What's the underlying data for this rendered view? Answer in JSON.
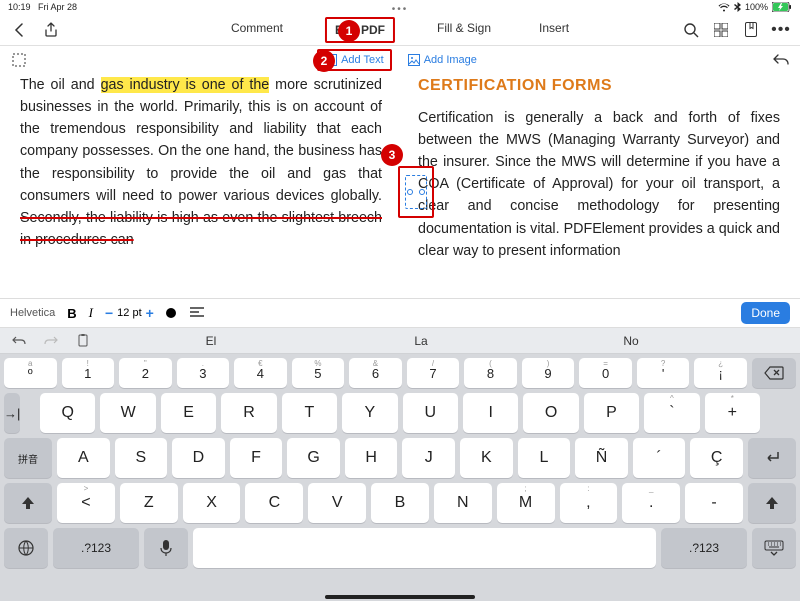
{
  "status": {
    "time": "10:19",
    "date": "Fri Apr 28",
    "battery": "100%"
  },
  "tabs": {
    "comment": "Comment",
    "edit": "Edit PDF",
    "fillsign": "Fill & Sign",
    "insert": "Insert"
  },
  "secbar": {
    "add_text": "Add Text",
    "add_image": "Add Image"
  },
  "callouts": {
    "c1": "1",
    "c2": "2",
    "c3": "3"
  },
  "doc": {
    "left_pre": "The oil and ",
    "left_hl": "gas industry is one of the",
    "left_post": " more scrutinized businesses in the world. Primarily, this is on account of the tremendous responsibility and liability that each company possesses. On the one hand, the business has the responsibility to provide the oil and gas that consumers will need to power various devices globally. ",
    "left_strike": "Secondly, the liability is high as even the slightest breech in procedures can",
    "right_heading": "Certification Forms",
    "right_body": "Certification is generally a back and forth of fixes between the MWS (Managing Warranty Surveyor) and the insurer. Since the MWS will determine if you have a COA (Certificate of Approval) for your oil transport, a clear and concise methodology for presenting documentation is vital. PDFElement provides a quick and clear way to present information"
  },
  "fmt": {
    "font": "Helvetica",
    "bold": "B",
    "italic": "I",
    "size": "12 pt",
    "done": "Done"
  },
  "sug": {
    "s1": "El",
    "s2": "La",
    "s3": "No"
  },
  "kbd": {
    "numhints": [
      "a",
      "!",
      "\"",
      ".",
      "€",
      "%",
      "&",
      "/",
      "(",
      ")",
      "=",
      "?",
      "¿"
    ],
    "nums": [
      "º",
      "1",
      "2",
      "3",
      "4",
      "5",
      "6",
      "7",
      "8",
      "9",
      "0",
      "'",
      "¡"
    ],
    "row1hints": [
      "",
      "",
      "",
      "",
      "",
      "",
      "",
      "",
      "",
      "",
      "^",
      "*"
    ],
    "row1": [
      "Q",
      "W",
      "E",
      "R",
      "T",
      "Y",
      "U",
      "I",
      "O",
      "P",
      "`",
      "+"
    ],
    "row2": [
      "A",
      "S",
      "D",
      "F",
      "G",
      "H",
      "J",
      "K",
      "L",
      "Ñ",
      "´",
      "Ç"
    ],
    "row3hints": [
      "",
      ">",
      "",
      "",
      "",
      "",
      "",
      "",
      ";",
      ":",
      "_"
    ],
    "row3": [
      "⇧",
      "<",
      "Z",
      "X",
      "C",
      "V",
      "B",
      "N",
      "M",
      ",",
      ".",
      "-",
      "⇧"
    ],
    "pinyin": "拼音",
    "tab": "→|",
    "numsym": ".?123"
  }
}
